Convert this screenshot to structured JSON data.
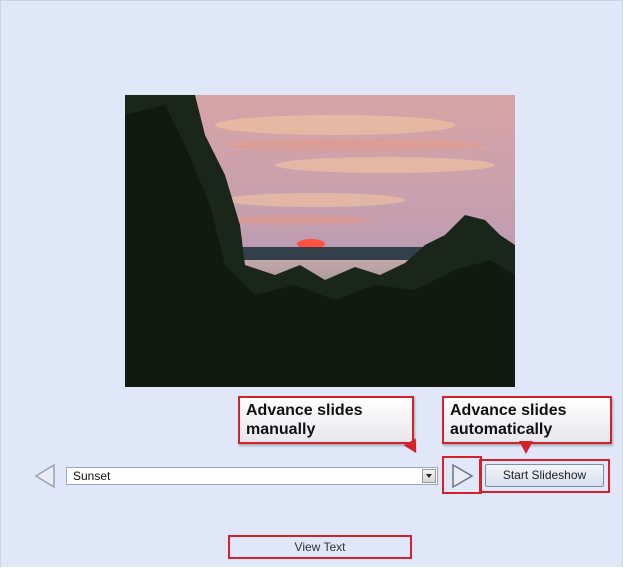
{
  "slideshow": {
    "image_title": "Sunset",
    "start_button_label": "Start Slideshow",
    "view_text_label": "View Text"
  },
  "annotations": {
    "manual_label_line1": "Advance slides",
    "manual_label_line2": "manually",
    "auto_label_line1": "Advance slides",
    "auto_label_line2": "automatically",
    "highlight_color": "#d3222a"
  },
  "icons": {
    "prev": "left-triangle-arrow-icon",
    "next": "right-triangle-arrow-icon",
    "dropdown": "chevron-down-icon"
  }
}
